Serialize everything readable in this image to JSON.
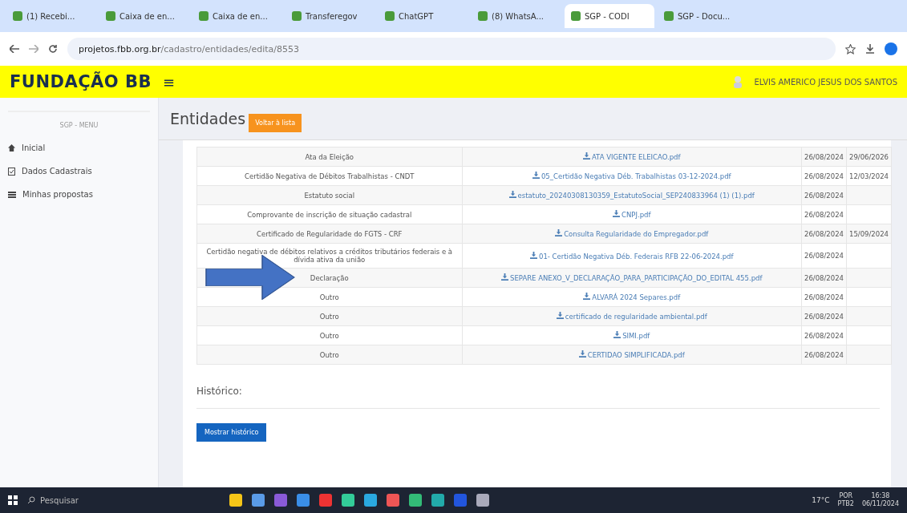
{
  "browser": {
    "tabs": [
      {
        "label": "(1) Recebi...",
        "selected": false
      },
      {
        "label": "Caixa de en...",
        "selected": false
      },
      {
        "label": "Caixa de en...",
        "selected": false
      },
      {
        "label": "Transferegov",
        "selected": false
      },
      {
        "label": "ChatGPT",
        "selected": false
      },
      {
        "label": "(8) WhatsA...",
        "selected": false
      },
      {
        "label": "SGP - CODI",
        "selected": true
      },
      {
        "label": "SGP - Docu...",
        "selected": false
      }
    ],
    "url_host": "projetos.fbb.org.br",
    "url_path": "/cadastro/entidades/edita/8553"
  },
  "header": {
    "logo": "FUNDAÇÃO BB",
    "menu_glyph": "≡",
    "user": "ELVIS AMERICO JESUS DOS SANTOS"
  },
  "sidebar": {
    "title": "SGP - MENU",
    "items": [
      {
        "label": "Inicial",
        "kind": "home"
      },
      {
        "label": "Dados Cadastrais",
        "kind": "form"
      },
      {
        "label": "Minhas propostas",
        "kind": "list"
      }
    ]
  },
  "page": {
    "title": "Entidades",
    "back_button": "Voltar à lista"
  },
  "documents": [
    {
      "type": "Ata da Eleição",
      "file": "ATA VIGENTE ELEICAO.pdf",
      "sent": "26/08/2024",
      "expires": "29/06/2026"
    },
    {
      "type": "Certidão Negativa de Débitos Trabalhistas - CNDT",
      "file": "05_Certidão Negativa Déb. Trabalhistas 03-12-2024.pdf",
      "sent": "26/08/2024",
      "expires": "12/03/2024"
    },
    {
      "type": "Estatuto social",
      "file": "estatuto_20240308130359_EstatutoSocial_SEP240833964 (1) (1).pdf",
      "sent": "26/08/2024"
    },
    {
      "type": "Comprovante de inscrição de situação cadastral",
      "file": "CNPJ.pdf",
      "sent": "26/08/2024"
    },
    {
      "type": "Certificado de Regularidade do FGTS - CRF",
      "file": "Consulta Regularidade do Empregador.pdf",
      "sent": "26/08/2024",
      "expires": "15/09/2024"
    },
    {
      "type": "Certidão negativa de débitos relativos a créditos tributários federais e à dívida ativa da união",
      "file": "01- Certidão Negativa Déb. Federais RFB 22-06-2024.pdf",
      "sent": "26/08/2024"
    },
    {
      "type": "Declaração",
      "file": "SEPARE ANEXO_V_DECLARAÇÃO_PARA_PARTICIPAÇÃO_DO_EDITAL 455.pdf",
      "sent": "26/08/2024"
    },
    {
      "type": "Outro",
      "file": "ALVARÁ 2024 Separes.pdf",
      "sent": "26/08/2024"
    },
    {
      "type": "Outro",
      "file": "certificado de regularidade ambiental.pdf",
      "sent": "26/08/2024"
    },
    {
      "type": "Outro",
      "file": "SIMI.pdf",
      "sent": "26/08/2024"
    },
    {
      "type": "Outro",
      "file": "CERTIDAO SIMPLIFICADA.pdf",
      "sent": "26/08/2024"
    }
  ],
  "history": {
    "label": "Histórico:",
    "button": "Mostrar histórico"
  },
  "taskbar": {
    "search": "Pesquisar",
    "weather": "17°C",
    "lang": "POR",
    "layout": "PTB2",
    "time": "16:38",
    "date": "06/11/2024"
  }
}
